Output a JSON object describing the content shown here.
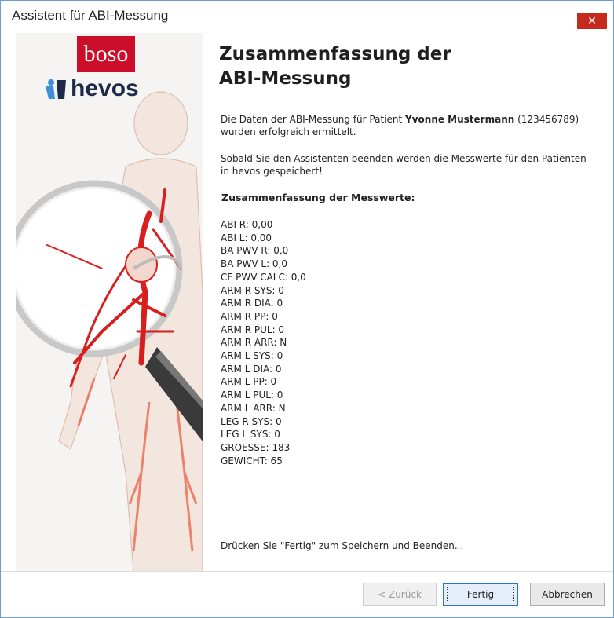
{
  "window": {
    "title": "Assistent für ABI-Messung",
    "close_glyph": "✕"
  },
  "branding": {
    "boso_logo": "boso",
    "hevos_logo": "hevos"
  },
  "main": {
    "heading_line1": "Zusammenfassung der",
    "heading_line2": "ABI-Messung",
    "intro_prefix": "Die Daten der ABI-Messung für Patient",
    "patient_name": "Yvonne Mustermann",
    "patient_id": "(123456789)",
    "intro_suffix": "wurden erfolgreich ermittelt.",
    "save_notice_line1": "Sobald Sie den Assistenten beenden werden die Messwerte für den Patienten",
    "save_notice_line2": "in hevos gespeichert!",
    "summary_title": "Zusammenfassung der Messwerte:",
    "measurements": [
      "ABI R: 0,00",
      "ABI L: 0,00",
      "BA PWV R: 0,0",
      "BA PWV L: 0,0",
      "CF PWV CALC: 0,0",
      "ARM R SYS: 0",
      "ARM R DIA: 0",
      "ARM R PP: 0",
      "ARM R PUL: 0",
      "ARM R ARR: N",
      "ARM L SYS: 0",
      "ARM L DIA: 0",
      "ARM L PP: 0",
      "ARM L PUL: 0",
      "ARM L ARR: N",
      "LEG R SYS: 0",
      "LEG L SYS: 0",
      "GROESSE: 183",
      "GEWICHT: 65"
    ],
    "finish_hint": "Drücken Sie \"Fertig\" zum Speichern und Beenden..."
  },
  "buttons": {
    "back": "< Zurück",
    "finish": "Fertig",
    "cancel": "Abbrechen"
  },
  "colors": {
    "brand_red": "#cc0d2a",
    "hevos_navy": "#1d2b4a",
    "artery_red": "#d81e1e",
    "close_red": "#c42b1c"
  }
}
